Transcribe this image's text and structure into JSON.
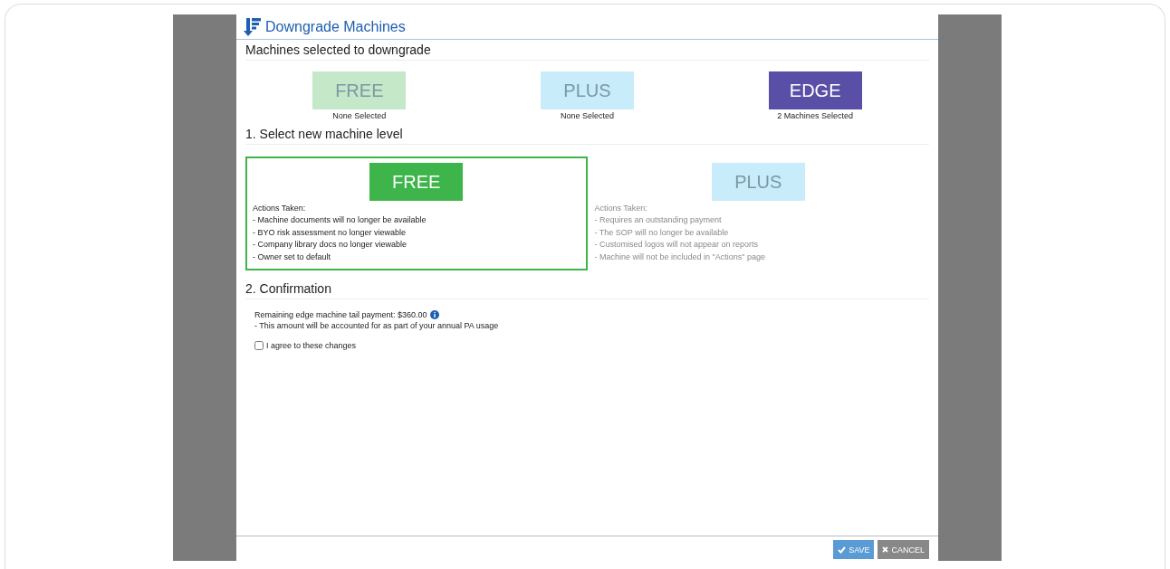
{
  "dialog": {
    "title": "Downgrade Machines"
  },
  "selected_section": {
    "heading": "Machines selected to downgrade",
    "tiles": [
      {
        "label": "FREE",
        "caption": "None Selected",
        "color": "#c5e8c9",
        "active": false
      },
      {
        "label": "PLUS",
        "caption": "None Selected",
        "color": "#c8ecfa",
        "active": false
      },
      {
        "label": "EDGE",
        "caption": "2 Machines Selected",
        "color": "#5a4fa6",
        "active": true
      }
    ]
  },
  "level_section": {
    "heading": "1. Select new machine level",
    "options": [
      {
        "label": "FREE",
        "color": "#3db54a",
        "selected": true,
        "actions_title": "Actions Taken:",
        "actions": [
          "- Machine documents will no longer be available",
          "- BYO risk assessment no longer viewable",
          "- Company library docs no longer viewable",
          "- Owner set to default"
        ]
      },
      {
        "label": "PLUS",
        "color": "#c8ecfa",
        "selected": false,
        "actions_title": "Actions Taken:",
        "actions": [
          "- Requires an outstanding payment",
          "- The SOP will no longer be available",
          "- Customised logos will not appear on reports",
          "- Machine will not be included in \"Actions\" page"
        ]
      }
    ]
  },
  "confirmation": {
    "heading": "2. Confirmation",
    "payment": "Remaining edge machine tail payment: $360.00",
    "note": "- This amount will be accounted for as part of your annual PA usage",
    "agree": {
      "label": "I agree to these changes",
      "checked": false
    }
  },
  "buttons": {
    "save": "SAVE",
    "cancel": "CANCEL"
  }
}
